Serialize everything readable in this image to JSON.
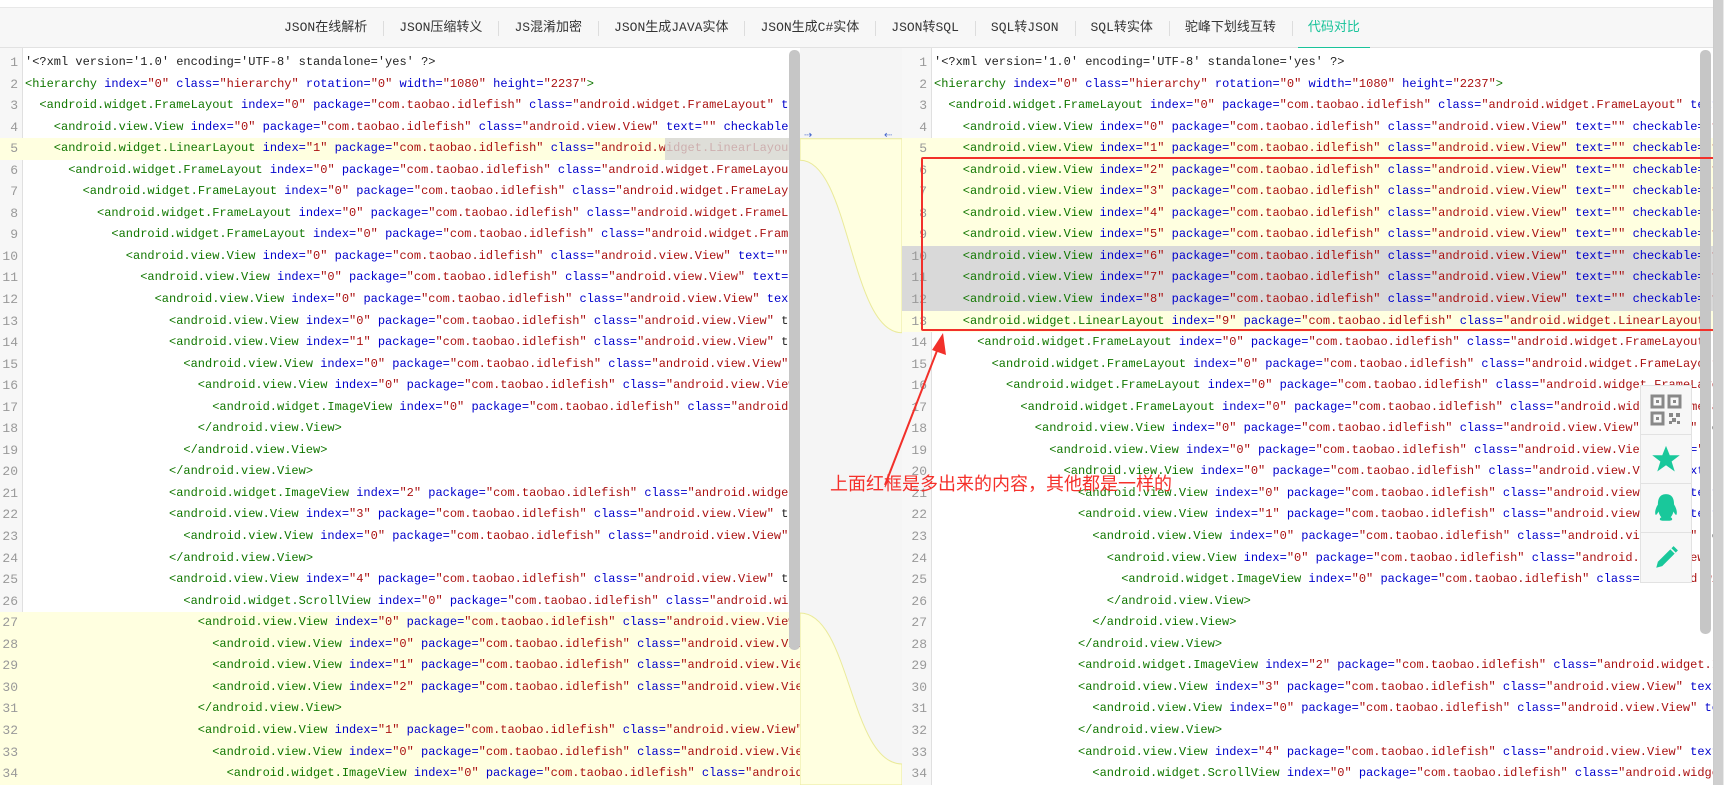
{
  "nav": {
    "tabs": [
      "JSON在线解析",
      "JSON压缩转义",
      "JS混淆加密",
      "JSON生成JAVA实体",
      "JSON生成C#实体",
      "JSON转SQL",
      "SQL转JSON",
      "SQL转实体",
      "驼峰下划线互转",
      "代码对比"
    ],
    "active_index": 9
  },
  "colors": {
    "accent": "#19c39a",
    "tag": "#117700",
    "attr": "#0000cc",
    "value": "#aa1111",
    "inserted_bg": "#ffffe0",
    "changed_bg": "#d9d9d9",
    "annotation": "#f5302a"
  },
  "left_editor": {
    "lines": [
      {
        "n": 1,
        "indent": 0,
        "text": "'<?xml version='1.0' encoding='UTF-8' standalone='yes' ?>",
        "plain": true
      },
      {
        "n": 2,
        "indent": 0,
        "text": "<hierarchy index=\"0\" class=\"hierarchy\" rotation=\"0\" width=\"1080\" height=\"2237\">"
      },
      {
        "n": 3,
        "indent": 1,
        "text": "<android.widget.FrameLayout index=\"0\" package=\"com.taobao.idlefish\" class=\"android.widget.FrameLayout\" text=\""
      },
      {
        "n": 4,
        "indent": 2,
        "text": "<android.view.View index=\"0\" package=\"com.taobao.idlefish\" class=\"android.view.View\" text=\"\" checkable=\"fal"
      },
      {
        "n": 5,
        "indent": 2,
        "text": "<android.widget.LinearLayout index=\"1\" package=\"com.taobao.idlefish\" class=\"android.widget.LinearLayout\" te",
        "state": "ins-partial"
      },
      {
        "n": 6,
        "indent": 3,
        "text": "<android.widget.FrameLayout index=\"0\" package=\"com.taobao.idlefish\" class=\"android.widget.FrameLayout\" te"
      },
      {
        "n": 7,
        "indent": 4,
        "text": "<android.widget.FrameLayout index=\"0\" package=\"com.taobao.idlefish\" class=\"android.widget.FrameLayout\""
      },
      {
        "n": 8,
        "indent": 5,
        "text": "<android.widget.FrameLayout index=\"0\" package=\"com.taobao.idlefish\" class=\"android.widget.FrameLayou"
      },
      {
        "n": 9,
        "indent": 6,
        "text": "<android.widget.FrameLayout index=\"0\" package=\"com.taobao.idlefish\" class=\"android.widget.FrameLay"
      },
      {
        "n": 10,
        "indent": 7,
        "text": "<android.view.View index=\"0\" package=\"com.taobao.idlefish\" class=\"android.view.View\" text=\"\" reso"
      },
      {
        "n": 11,
        "indent": 8,
        "text": "<android.view.View index=\"0\" package=\"com.taobao.idlefish\" class=\"android.view.View\" text=\"\" re"
      },
      {
        "n": 12,
        "indent": 9,
        "text": "<android.view.View index=\"0\" package=\"com.taobao.idlefish\" class=\"android.view.View\" text=\""
      },
      {
        "n": 13,
        "indent": 10,
        "text": "<android.view.View index=\"0\" package=\"com.taobao.idlefish\" class=\"android.view.View\" text"
      },
      {
        "n": 14,
        "indent": 10,
        "text": "<android.view.View index=\"1\" package=\"com.taobao.idlefish\" class=\"android.view.View\" text"
      },
      {
        "n": 15,
        "indent": 11,
        "text": "<android.view.View index=\"0\" package=\"com.taobao.idlefish\" class=\"android.view.View\" te"
      },
      {
        "n": 16,
        "indent": 12,
        "text": "<android.view.View index=\"0\" package=\"com.taobao.idlefish\" class=\"android.view.View\" t"
      },
      {
        "n": 17,
        "indent": 13,
        "text": "<android.widget.ImageView index=\"0\" package=\"com.taobao.idlefish\" class=\"android.widg"
      },
      {
        "n": 18,
        "indent": 12,
        "text": "</android.view.View>"
      },
      {
        "n": 19,
        "indent": 11,
        "text": "</android.view.View>"
      },
      {
        "n": 20,
        "indent": 10,
        "text": "</android.view.View>"
      },
      {
        "n": 21,
        "indent": 10,
        "text": "<android.widget.ImageView index=\"2\" package=\"com.taobao.idlefish\" class=\"android.widget.Ima"
      },
      {
        "n": 22,
        "indent": 10,
        "text": "<android.view.View index=\"3\" package=\"com.taobao.idlefish\" class=\"android.view.View\" text"
      },
      {
        "n": 23,
        "indent": 11,
        "text": "<android.view.View index=\"0\" package=\"com.taobao.idlefish\" class=\"android.view.View\" tex"
      },
      {
        "n": 24,
        "indent": 10,
        "text": "</android.view.View>"
      },
      {
        "n": 25,
        "indent": 10,
        "text": "<android.view.View index=\"4\" package=\"com.taobao.idlefish\" class=\"android.view.View\" text"
      },
      {
        "n": 26,
        "indent": 11,
        "text": "<android.widget.ScrollView index=\"0\" package=\"com.taobao.idlefish\" class=\"android.widget."
      },
      {
        "n": 27,
        "indent": 12,
        "text": "<android.view.View index=\"0\" package=\"com.taobao.idlefish\" class=\"android.view.View\" t",
        "state": "ins"
      },
      {
        "n": 28,
        "indent": 13,
        "text": "<android.view.View index=\"0\" package=\"com.taobao.idlefish\" class=\"android.view.View\"",
        "state": "ins"
      },
      {
        "n": 29,
        "indent": 13,
        "text": "<android.view.View index=\"1\" package=\"com.taobao.idlefish\" class=\"android.view.View\"",
        "state": "ins"
      },
      {
        "n": 30,
        "indent": 13,
        "text": "<android.view.View index=\"2\" package=\"com.taobao.idlefish\" class=\"android.view.View\"",
        "state": "ins"
      },
      {
        "n": 31,
        "indent": 12,
        "text": "</android.view.View>",
        "state": "ins"
      },
      {
        "n": 32,
        "indent": 12,
        "text": "<android.view.View index=\"1\" package=\"com.taobao.idlefish\" class=\"android.view.View\" t",
        "state": "ins"
      },
      {
        "n": 33,
        "indent": 13,
        "text": "<android.view.View index=\"0\" package=\"com.taobao.idlefish\" class=\"android.view.View\"",
        "state": "ins"
      },
      {
        "n": 34,
        "indent": 14,
        "text": "<android.widget.ImageView index=\"0\" package=\"com.taobao.idlefish\" class=\"android.",
        "state": "ins"
      }
    ]
  },
  "right_editor": {
    "lines": [
      {
        "n": 1,
        "indent": 0,
        "text": "'<?xml version='1.0' encoding='UTF-8' standalone='yes' ?>",
        "plain": true
      },
      {
        "n": 2,
        "indent": 0,
        "text": "<hierarchy index=\"0\" class=\"hierarchy\" rotation=\"0\" width=\"1080\" height=\"2237\">"
      },
      {
        "n": 3,
        "indent": 1,
        "text": "<android.widget.FrameLayout index=\"0\" package=\"com.taobao.idlefish\" class=\"android.widget.FrameLayout\" text=\""
      },
      {
        "n": 4,
        "indent": 2,
        "text": "<android.view.View index=\"0\" package=\"com.taobao.idlefish\" class=\"android.view.View\" text=\"\" checkable=\"fal"
      },
      {
        "n": 5,
        "indent": 2,
        "text": "<android.view.View index=\"1\" package=\"com.taobao.idlefish\" class=\"android.view.View\" text=\"\" checkable=\"fal",
        "state": "ins"
      },
      {
        "n": 6,
        "indent": 2,
        "text": "<android.view.View index=\"2\" package=\"com.taobao.idlefish\" class=\"android.view.View\" text=\"\" checkable=\"fal",
        "state": "ins"
      },
      {
        "n": 7,
        "indent": 2,
        "text": "<android.view.View index=\"3\" package=\"com.taobao.idlefish\" class=\"android.view.View\" text=\"\" checkable=\"fal",
        "state": "ins"
      },
      {
        "n": 8,
        "indent": 2,
        "text": "<android.view.View index=\"4\" package=\"com.taobao.idlefish\" class=\"android.view.View\" text=\"\" checkable=\"fal",
        "state": "ins"
      },
      {
        "n": 9,
        "indent": 2,
        "text": "<android.view.View index=\"5\" package=\"com.taobao.idlefish\" class=\"android.view.View\" text=\"\" checkable=\"fal",
        "state": "ins"
      },
      {
        "n": 10,
        "indent": 2,
        "text": "<android.view.View index=\"6\" package=\"com.taobao.idlefish\" class=\"android.view.View\" text=\"\" checkable=\"fal",
        "state": "chg"
      },
      {
        "n": 11,
        "indent": 2,
        "text": "<android.view.View index=\"7\" package=\"com.taobao.idlefish\" class=\"android.view.View\" text=\"\" checkable=\"fal",
        "state": "chg"
      },
      {
        "n": 12,
        "indent": 2,
        "text": "<android.view.View index=\"8\" package=\"com.taobao.idlefish\" class=\"android.view.View\" text=\"\" checkable=\"fal",
        "state": "chg"
      },
      {
        "n": 13,
        "indent": 2,
        "text": "<android.widget.LinearLayout index=\"9\" package=\"com.taobao.idlefish\" class=\"android.widget.LinearLayout\" te",
        "state": "ins"
      },
      {
        "n": 14,
        "indent": 3,
        "text": "<android.widget.FrameLayout index=\"0\" package=\"com.taobao.idlefish\" class=\"android.widget.FrameLayout\" te"
      },
      {
        "n": 15,
        "indent": 4,
        "text": "<android.widget.FrameLayout index=\"0\" package=\"com.taobao.idlefish\" class=\"android.widget.FrameLayout\""
      },
      {
        "n": 16,
        "indent": 5,
        "text": "<android.widget.FrameLayout index=\"0\" package=\"com.taobao.idlefish\" class=\"android.widget.FrameLayout"
      },
      {
        "n": 17,
        "indent": 6,
        "text": "<android.widget.FrameLayout index=\"0\" package=\"com.taobao.idlefish\" class=\"android.widget.FrameLayo"
      },
      {
        "n": 18,
        "indent": 7,
        "text": "<android.view.View index=\"0\" package=\"com.taobao.idlefish\" class=\"android.view.View\" text=\"\" reso"
      },
      {
        "n": 19,
        "indent": 8,
        "text": "<android.view.View index=\"0\" package=\"com.taobao.idlefish\" class=\"android.view.View\" text=\"\" re"
      },
      {
        "n": 20,
        "indent": 9,
        "text": "<android.view.View index=\"0\" package=\"com.taobao.idlefish\" class=\"android.view.View\" text=\"\""
      },
      {
        "n": 21,
        "indent": 10,
        "text": "<android.view.View index=\"0\" package=\"com.taobao.idlefish\" class=\"android.view.View\" text=\""
      },
      {
        "n": 22,
        "indent": 10,
        "text": "<android.view.View index=\"1\" package=\"com.taobao.idlefish\" class=\"android.view.View\" text=\""
      },
      {
        "n": 23,
        "indent": 11,
        "text": "<android.view.View index=\"0\" package=\"com.taobao.idlefish\" class=\"android.view.View\" te"
      },
      {
        "n": 24,
        "indent": 12,
        "text": "<android.view.View index=\"0\" package=\"com.taobao.idlefish\" class=\"android.view.View\" t"
      },
      {
        "n": 25,
        "indent": 13,
        "text": "<android.widget.ImageView index=\"0\" package=\"com.taobao.idlefish\" class=\"android.widg"
      },
      {
        "n": 26,
        "indent": 12,
        "text": "</android.view.View>"
      },
      {
        "n": 27,
        "indent": 11,
        "text": "</android.view.View>"
      },
      {
        "n": 28,
        "indent": 10,
        "text": "</android.view.View>"
      },
      {
        "n": 29,
        "indent": 10,
        "text": "<android.widget.ImageView index=\"2\" package=\"com.taobao.idlefish\" class=\"android.widget.Ima"
      },
      {
        "n": 30,
        "indent": 10,
        "text": "<android.view.View index=\"3\" package=\"com.taobao.idlefish\" class=\"android.view.View\" text=\""
      },
      {
        "n": 31,
        "indent": 11,
        "text": "<android.view.View index=\"0\" package=\"com.taobao.idlefish\" class=\"android.view.View\" text="
      },
      {
        "n": 32,
        "indent": 10,
        "text": "</android.view.View>"
      },
      {
        "n": 33,
        "indent": 10,
        "text": "<android.view.View index=\"4\" package=\"com.taobao.idlefish\" class=\"android.view.View\" text=\""
      },
      {
        "n": 34,
        "indent": 11,
        "text": "<android.widget.ScrollView index=\"0\" package=\"com.taobao.idlefish\" class=\"android.widget."
      }
    ]
  },
  "annotation": {
    "text": "上面红框是多出来的内容，其他都是一样的"
  },
  "float_panel": {
    "icons": [
      "qr-code-icon",
      "star-icon",
      "qq-penguin-icon",
      "pencil-icon"
    ]
  }
}
